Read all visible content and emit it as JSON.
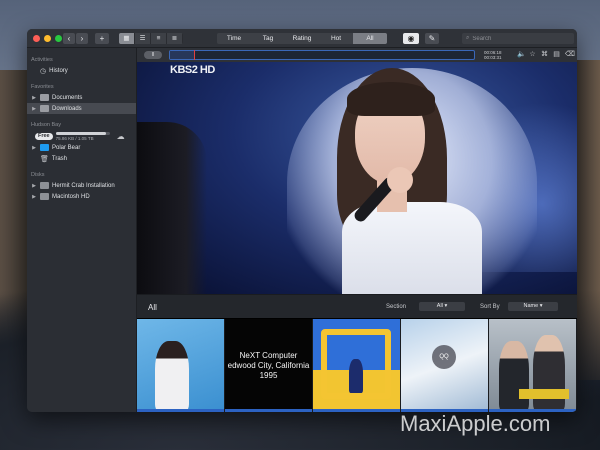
{
  "toolbar": {
    "add_label": "+",
    "filter_tabs": [
      {
        "label": "Time"
      },
      {
        "label": "Tag"
      },
      {
        "label": "Rating"
      },
      {
        "label": "Hot"
      },
      {
        "label": "All",
        "active": true
      }
    ],
    "search_placeholder": "Search"
  },
  "sidebar": {
    "sections": {
      "activities": "Activities",
      "favorites": "Favorites",
      "hudson_bay": "Hudson Bay",
      "disks": "Disks"
    },
    "activities_items": [
      {
        "label": "History",
        "icon": "clock-icon"
      }
    ],
    "favorites_items": [
      {
        "label": "Documents",
        "icon": "folder-icon"
      },
      {
        "label": "Downloads",
        "icon": "folder-icon",
        "selected": true
      }
    ],
    "hudson": {
      "free_label": "Free",
      "free_text": "75.86 KB / 1.05 TB",
      "free_fraction": 0.93,
      "items": [
        {
          "label": "Polar Bear",
          "icon": "folder-icon"
        },
        {
          "label": "Trash",
          "icon": "trash-icon"
        }
      ]
    },
    "disks_items": [
      {
        "label": "Hermit Crab Installation",
        "icon": "disk-icon"
      },
      {
        "label": "Macintosh HD",
        "icon": "disk-icon"
      }
    ]
  },
  "player": {
    "play_label": "II",
    "elapsed": "00:06:18",
    "remaining": "00:03:31",
    "progress": 0.08,
    "logo": "KBS2 HD"
  },
  "browser": {
    "title": "All",
    "section_label": "Section",
    "section_value": "All",
    "sortby_label": "Sort By",
    "sortby_value": "Name"
  },
  "thumbs": [
    {
      "caption": ""
    },
    {
      "caption_line1": "NeXT Computer",
      "caption_line2": "edwood City, California",
      "caption_line3": "1995"
    },
    {
      "caption": ""
    },
    {
      "caption": "QQ"
    },
    {
      "caption": ""
    }
  ],
  "watermark": "MaxiApple.com"
}
